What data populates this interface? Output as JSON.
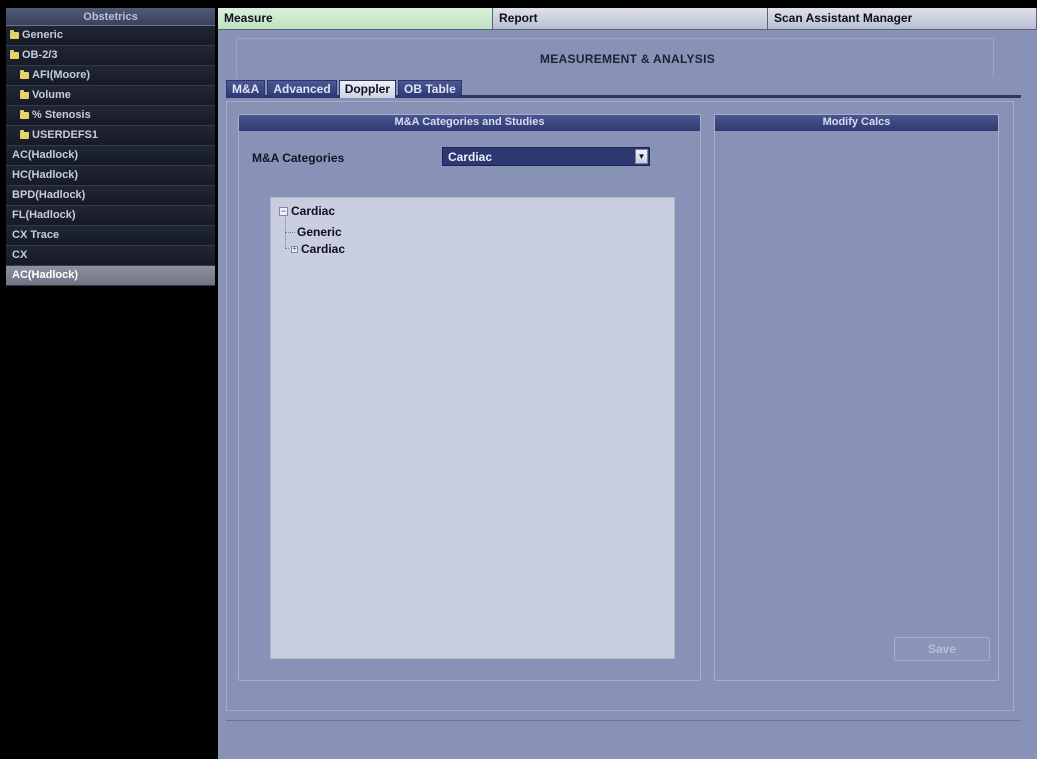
{
  "sidebar": {
    "title": "Obstetrics",
    "items": [
      {
        "label": "Generic",
        "folder": true,
        "level": 0
      },
      {
        "label": "OB-2/3",
        "folder": true,
        "level": 0
      },
      {
        "label": "AFI(Moore)",
        "folder": true,
        "level": 1
      },
      {
        "label": "Volume",
        "folder": true,
        "level": 1
      },
      {
        "label": "% Stenosis",
        "folder": true,
        "level": 1
      },
      {
        "label": "USERDEFS1",
        "folder": true,
        "level": 1
      },
      {
        "label": "AC(Hadlock)",
        "folder": false,
        "level": 1
      },
      {
        "label": "HC(Hadlock)",
        "folder": false,
        "level": 1
      },
      {
        "label": "BPD(Hadlock)",
        "folder": false,
        "level": 1
      },
      {
        "label": "FL(Hadlock)",
        "folder": false,
        "level": 1
      },
      {
        "label": "CX Trace",
        "folder": false,
        "level": 1
      },
      {
        "label": "CX",
        "folder": false,
        "level": 1
      },
      {
        "label": "AC(Hadlock)",
        "folder": false,
        "level": 1,
        "selected": true
      }
    ]
  },
  "top_tabs": [
    {
      "label": "Measure",
      "active": true
    },
    {
      "label": "Report",
      "active": false
    },
    {
      "label": "Scan Assistant Manager",
      "active": false
    }
  ],
  "main": {
    "title": "MEASUREMENT & ANALYSIS",
    "sub_tabs": [
      {
        "label": "M&A",
        "active": false
      },
      {
        "label": "Advanced",
        "active": false
      },
      {
        "label": "Doppler",
        "active": true
      },
      {
        "label": "OB Table",
        "active": false
      }
    ]
  },
  "categories_panel": {
    "title": "M&A Categories and Studies",
    "categories_label": "M&A Categories",
    "selected_category": "Cardiac",
    "tree": {
      "root": "Cardiac",
      "children": [
        {
          "label": "Generic",
          "expandable": false
        },
        {
          "label": "Cardiac",
          "expandable": true
        }
      ]
    }
  },
  "modify_panel": {
    "title": "Modify Calcs",
    "save_label": "Save"
  },
  "colors": {
    "main_background": "#8891b6",
    "panel_header": "#2f3a72",
    "active_top_tab": "#bfe3c1",
    "selected_sidebar_item": "#6e7483"
  }
}
